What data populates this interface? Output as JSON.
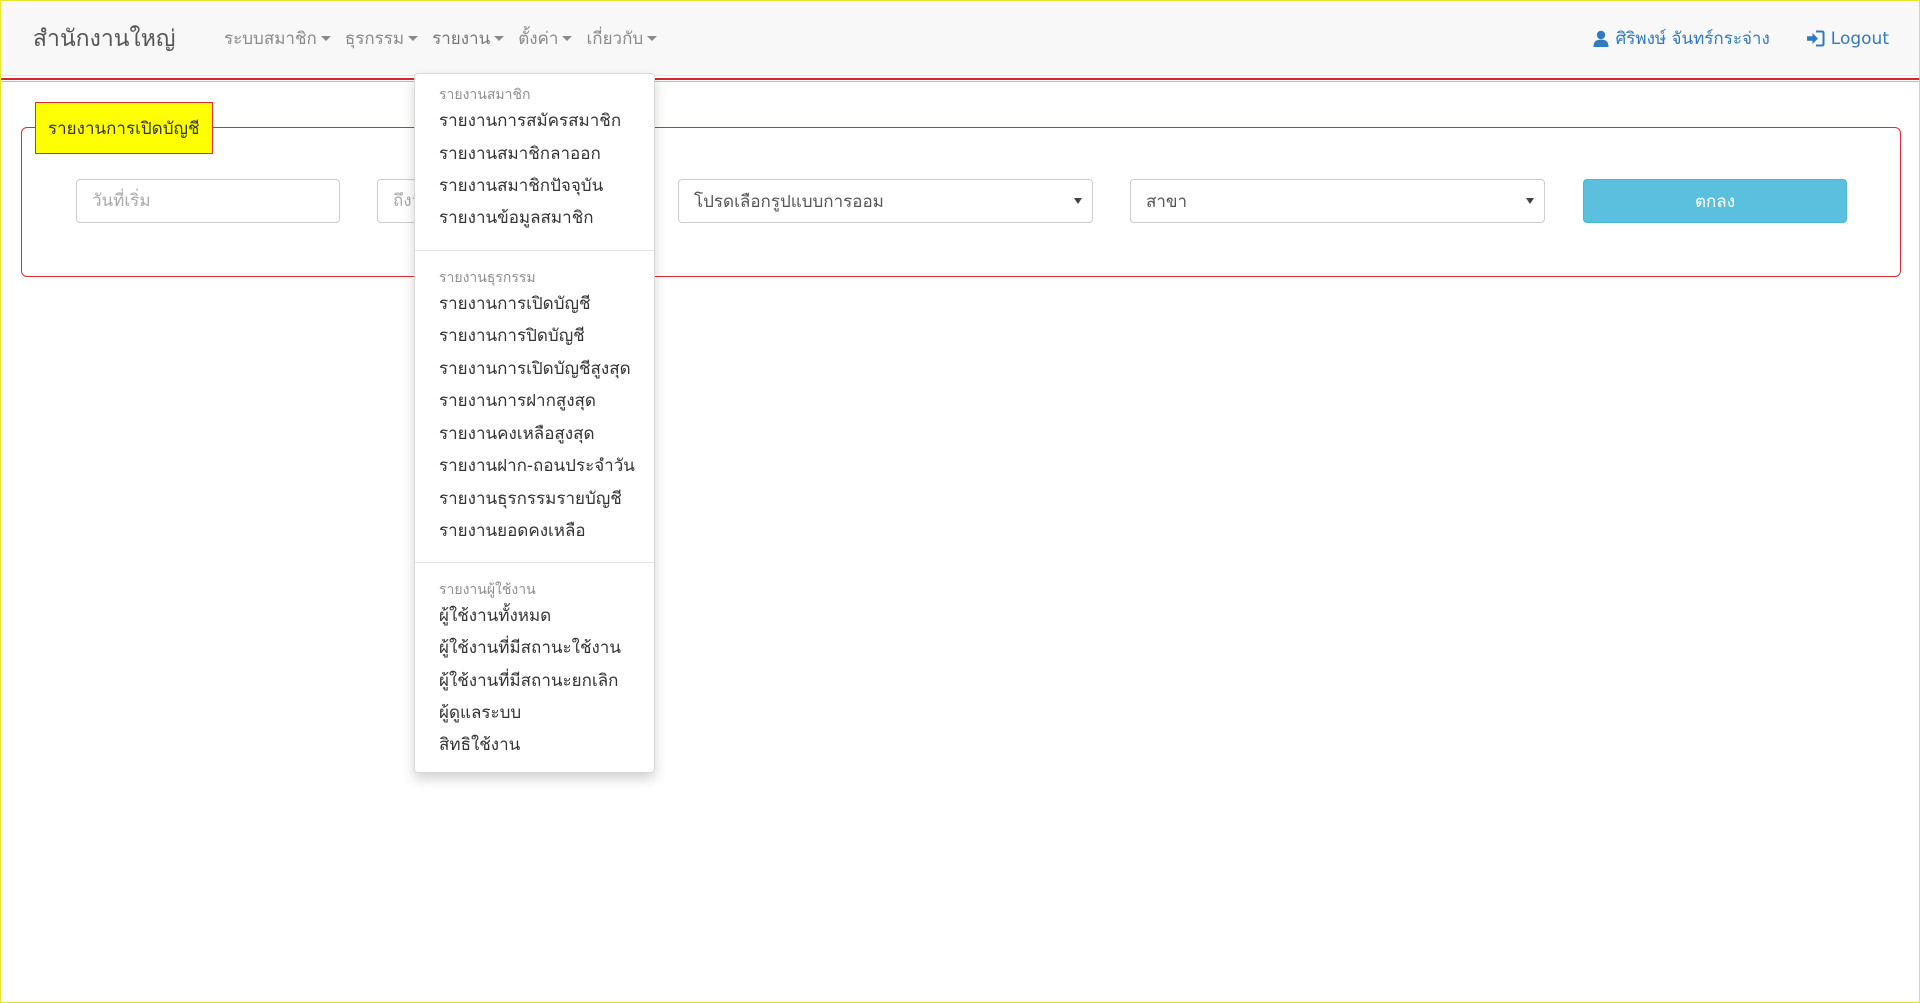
{
  "navbar": {
    "brand": "สำนักงานใหญ่",
    "menus": [
      {
        "label": "ระบบสมาชิก"
      },
      {
        "label": "ธุรกรรม"
      },
      {
        "label": "รายงาน"
      },
      {
        "label": "ตั้งค่า"
      },
      {
        "label": "เกี่ยวกับ"
      }
    ],
    "user_name": "ศิริพงษ์ จันทร์กระจ่าง",
    "logout_label": "Logout",
    "link_color": "#2f7ac2"
  },
  "panel": {
    "title": "รายงานการเปิดบัญชี",
    "start_date_placeholder": "วันที่เริ่ม",
    "end_date_placeholder": "ถึงวันที่",
    "savings_type_selected": "โปรดเลือกรูปแบบการออม",
    "branch_selected": "สาขา",
    "submit_label": "ตกลง",
    "accent_color": "#e22a33",
    "title_bg": "#ffff00",
    "submit_color": "#5bc0de"
  },
  "dropdown": {
    "sections": [
      {
        "header": "รายงานสมาชิก",
        "items": [
          "รายงานการสมัครสมาชิก",
          "รายงานสมาชิกลาออก",
          "รายงานสมาชิกปัจจุบัน",
          "รายงานข้อมูลสมาชิก"
        ]
      },
      {
        "header": "รายงานธุรกรรม",
        "items": [
          "รายงานการเปิดบัญชี",
          "รายงานการปิดบัญชี",
          "รายงานการเปิดบัญชีสูงสุด",
          "รายงานการฝากสูงสุด",
          "รายงานคงเหลือสูงสุด",
          "รายงานฝาก-ถอนประจำวัน",
          "รายงานธุรกรรมรายบัญชี",
          "รายงานยอดคงเหลือ"
        ]
      },
      {
        "header": "รายงานผู้ใช้งาน",
        "items": [
          "ผู้ใช้งานทั้งหมด",
          "ผู้ใช้งานที่มีสถานะใช้งาน",
          "ผู้ใช้งานที่มีสถานะยกเลิก",
          "ผู้ดูแลระบบ",
          "สิทธิใช้งาน"
        ]
      }
    ]
  }
}
